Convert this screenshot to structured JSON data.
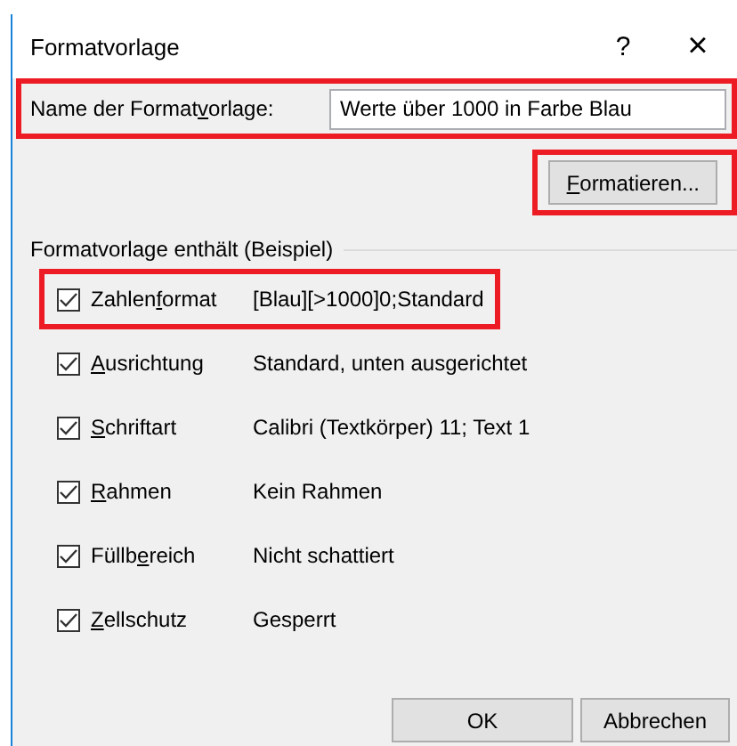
{
  "window": {
    "title": "Formatvorlage",
    "help": "?",
    "close": "×"
  },
  "name_field": {
    "label_parts": {
      "start": "Name der Format",
      "key": "v",
      "rest": "orlage:"
    },
    "value": "Werte über 1000 in Farbe Blau",
    "highlighted": true
  },
  "format_button": {
    "label_parts": {
      "key": "F",
      "rest": "ormatieren..."
    },
    "highlighted": true
  },
  "group": {
    "title": "Formatvorlage enthält (Beispiel)"
  },
  "items": [
    {
      "label_parts": {
        "start": "Zahlen",
        "key": "f",
        "rest": "ormat"
      },
      "value": "[Blau][>1000]0;Standard",
      "checked": true,
      "highlighted": true
    },
    {
      "label_parts": {
        "key": "A",
        "rest": "usrichtung"
      },
      "value": "Standard, unten ausgerichtet",
      "checked": true,
      "highlighted": false
    },
    {
      "label_parts": {
        "key": "S",
        "rest": "chriftart"
      },
      "value": "Calibri (Textkörper) 11; Text 1",
      "checked": true,
      "highlighted": false
    },
    {
      "label_parts": {
        "key": "R",
        "rest": "ahmen"
      },
      "value": "Kein Rahmen",
      "checked": true,
      "highlighted": false
    },
    {
      "label_parts": {
        "start": "Füllb",
        "key": "e",
        "rest": "reich"
      },
      "value": "Nicht schattiert",
      "checked": true,
      "highlighted": false
    },
    {
      "label_parts": {
        "key": "Z",
        "rest": "ellschutz"
      },
      "value": "Gesperrt",
      "checked": true,
      "highlighted": false
    }
  ],
  "buttons": [
    {
      "label": "OK"
    },
    {
      "label": "Abbrechen"
    }
  ]
}
